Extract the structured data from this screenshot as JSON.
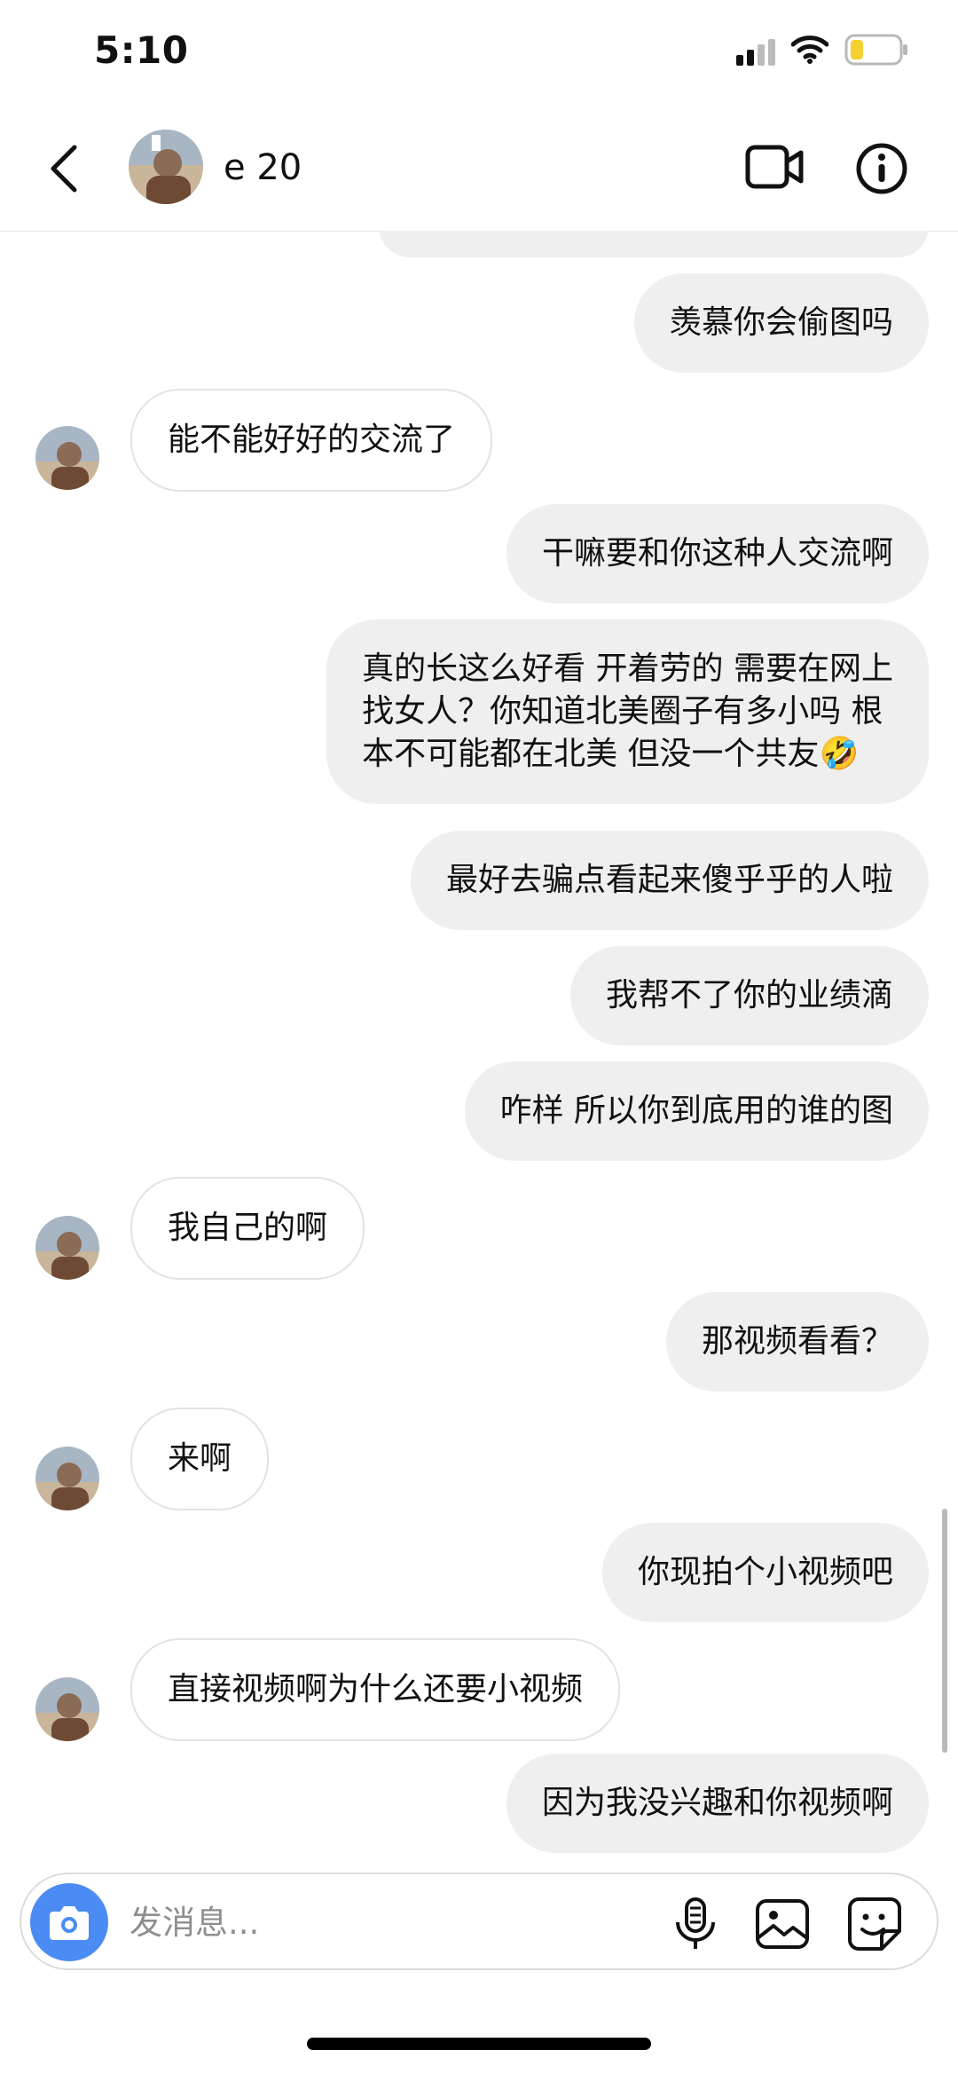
{
  "status_bar": {
    "time": "5:10"
  },
  "header": {
    "contact_name": "e   20"
  },
  "messages": [
    {
      "side": "out",
      "text": "羡慕你会偷图吗"
    },
    {
      "side": "in",
      "text": "能不能好好的交流了"
    },
    {
      "side": "out",
      "text": "干嘛要和你这种人交流啊"
    },
    {
      "side": "out",
      "text": "真的长这么好看 开着劳的 需要在网上\n找女人？你知道北美圈子有多小吗 根\n本不可能都在北美 但没一个共友🤣"
    },
    {
      "side": "out",
      "text": "最好去骗点看起来傻乎乎的人啦"
    },
    {
      "side": "out",
      "text": "我帮不了你的业绩滴"
    },
    {
      "side": "out",
      "text": "咋样 所以你到底用的谁的图"
    },
    {
      "side": "in",
      "text": "我自己的啊"
    },
    {
      "side": "out",
      "text": "那视频看看？"
    },
    {
      "side": "in",
      "text": "来啊"
    },
    {
      "side": "out",
      "text": "你现拍个小视频吧"
    },
    {
      "side": "in",
      "text": "直接视频啊为什么还要小视频"
    },
    {
      "side": "out",
      "text": "因为我没兴趣和你视频啊"
    }
  ],
  "composer": {
    "placeholder": "发消息..."
  },
  "colors": {
    "outgoing_bubble": "#efefef",
    "incoming_bubble_border": "#e3e3e3",
    "camera_button": "#4a8cf3",
    "battery_level": "#f5d130"
  },
  "icons": [
    "signal-icon",
    "wifi-icon",
    "battery-icon",
    "back-arrow-icon",
    "video-call-icon",
    "info-icon",
    "camera-icon",
    "microphone-icon",
    "gallery-icon",
    "sticker-icon"
  ]
}
